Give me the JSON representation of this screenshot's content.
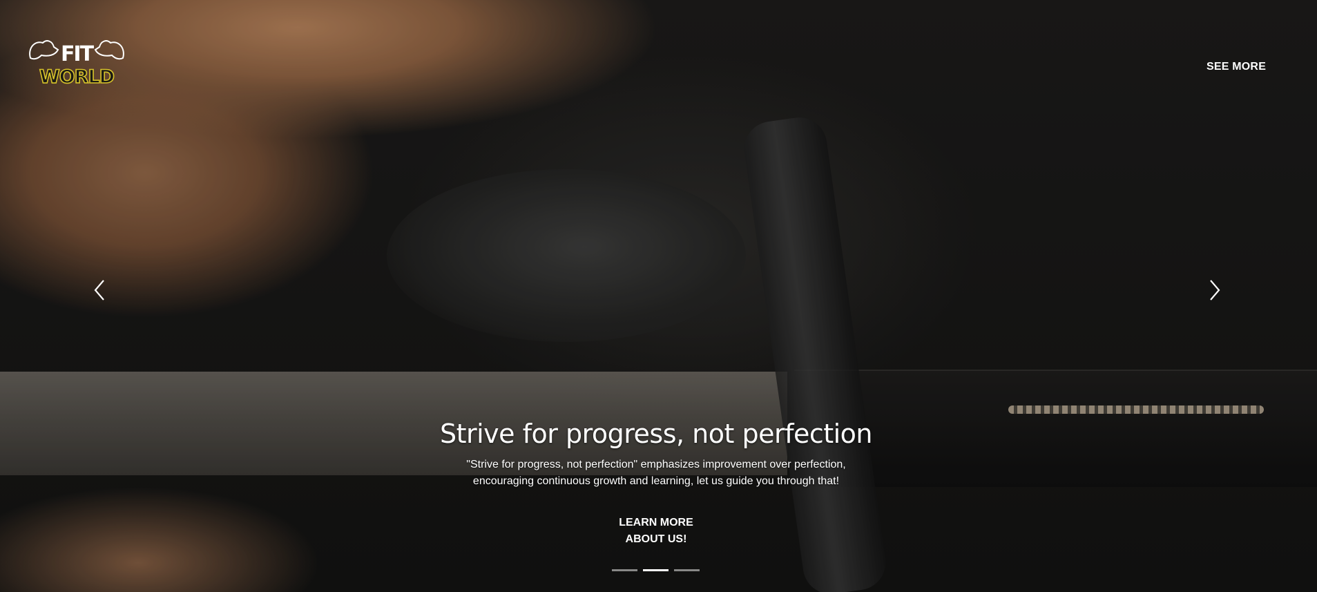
{
  "brand": {
    "logo_line1": "FIT",
    "logo_line2": "WORLD",
    "accent_color": "#d7c32a"
  },
  "nav": {
    "see_more_label": "SEE MORE"
  },
  "carousel": {
    "prev_icon": "chevron-left-icon",
    "next_icon": "chevron-right-icon",
    "slide_count": 3,
    "active_index": 1
  },
  "slide": {
    "title": "Strive for progress, not perfection",
    "description": "\"Strive for progress, not perfection\" emphasizes improvement over perfection, encouraging continuous growth and learning, let us guide you through that!",
    "cta_line1": "LEARN MORE",
    "cta_line2": "ABOUT US!"
  }
}
